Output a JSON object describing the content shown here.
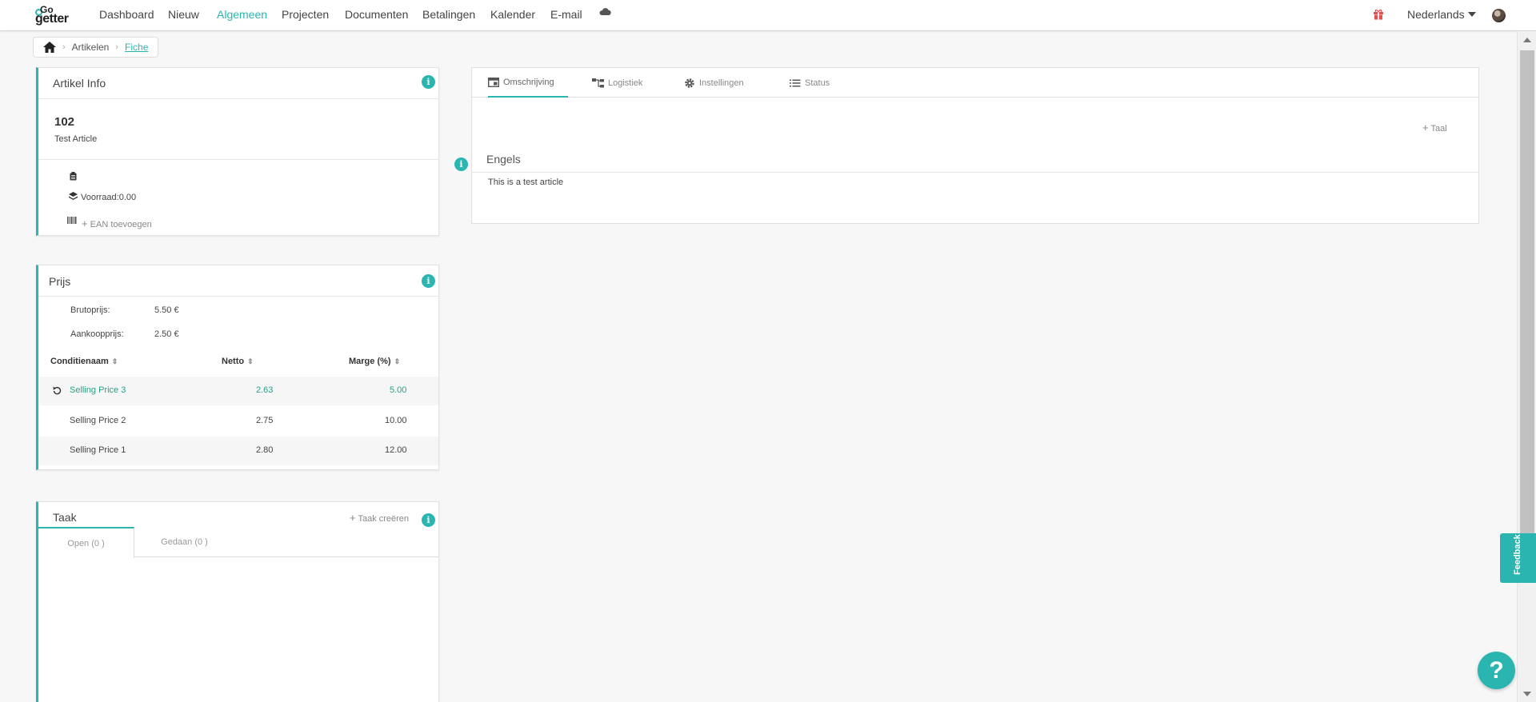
{
  "brand": {
    "top": "Go",
    "bottom": "getter"
  },
  "nav": {
    "items": [
      "Dashboard",
      "Nieuw",
      "Algemeen",
      "Projecten",
      "Documenten",
      "Betalingen",
      "Kalender",
      "E-mail"
    ],
    "active": "Algemeen",
    "language": "Nederlands"
  },
  "breadcrumb": {
    "level1": "Artikelen",
    "level2": "Fiche"
  },
  "article_info": {
    "title": "Artikel Info",
    "code": "102",
    "name": "Test Article",
    "stock": "Voorraad:0.00",
    "add_ean": "EAN toevoegen"
  },
  "price": {
    "title": "Prijs",
    "gross_label": "Brutoprijs:",
    "gross_value": "5.50 €",
    "purchase_label": "Aankoopprijs:",
    "purchase_value": "2.50 €",
    "columns": [
      "Conditienaam",
      "Netto",
      "Marge (%)"
    ],
    "rows": [
      {
        "name": "Selling Price 3",
        "net": "2.63",
        "margin": "5.00"
      },
      {
        "name": "Selling Price 2",
        "net": "2.75",
        "margin": "10.00"
      },
      {
        "name": "Selling Price 1",
        "net": "2.80",
        "margin": "12.00"
      }
    ]
  },
  "task": {
    "title": "Taak",
    "create": "Taak creëren",
    "tab_open": "Open (0 )",
    "tab_done": "Gedaan (0 )"
  },
  "detail": {
    "tabs": [
      "Omschrijving",
      "Logistiek",
      "Instellingen",
      "Status"
    ],
    "add_language": "Taal",
    "language": "Engels",
    "description": "This is a test article"
  },
  "feedback": "Feedback",
  "help": "?",
  "colors": {
    "accent": "#2bb5b0",
    "green_text": "#2aa08a",
    "gift": "#e05252"
  }
}
